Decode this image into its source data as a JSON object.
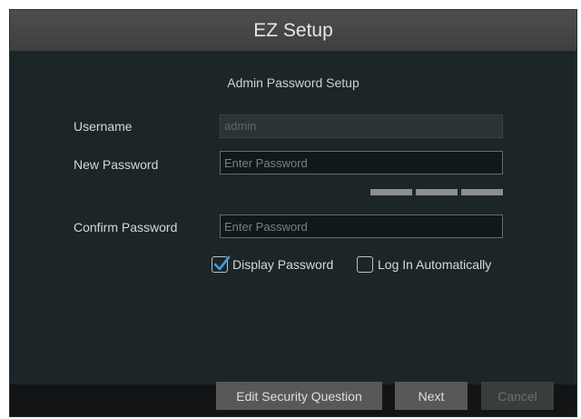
{
  "window": {
    "title": "EZ Setup"
  },
  "section": {
    "title": "Admin Password Setup"
  },
  "form": {
    "username": {
      "label": "Username",
      "value": "admin"
    },
    "new_password": {
      "label": "New Password",
      "placeholder": "Enter Password"
    },
    "confirm_password": {
      "label": "Confirm Password",
      "placeholder": "Enter Password"
    }
  },
  "options": {
    "display_password": {
      "label": "Display Password",
      "checked": true
    },
    "log_in_automatically": {
      "label": "Log In Automatically",
      "checked": false
    }
  },
  "footer": {
    "edit_security_question": "Edit Security Question",
    "next": "Next",
    "cancel": "Cancel"
  },
  "colors": {
    "background": "#1c2629",
    "titlebar": "#4a4a4a",
    "button": "#585858",
    "check_accent": "#3da0e0"
  }
}
